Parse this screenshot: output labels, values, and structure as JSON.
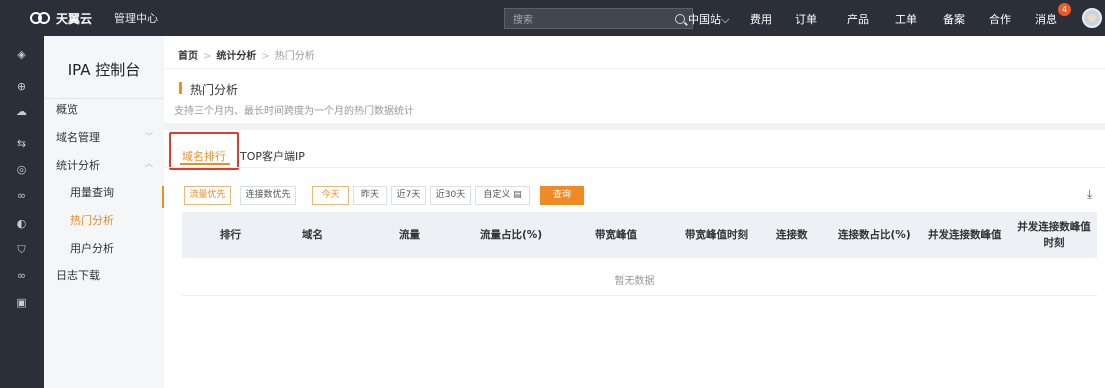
{
  "topbar": {
    "brand": "天翼云",
    "mgmt": "管理中心",
    "search_placeholder": "搜索",
    "nav": [
      "中国站⌵",
      "费用",
      "订单",
      "产品",
      "工单",
      "备案",
      "合作",
      "消息"
    ],
    "message_badge": "4"
  },
  "sidebar": {
    "title": "IPA 控制台",
    "items": {
      "overview": "概览",
      "domain_mgmt": "域名管理",
      "stats": "统计分析",
      "usage": "用量查询",
      "hot": "热门分析",
      "user": "用户分析",
      "logs": "日志下载"
    }
  },
  "breadcrumb": {
    "home": "首页",
    "section": "统计分析",
    "current": "热门分析",
    "sep": ">"
  },
  "page": {
    "title": "热门分析",
    "desc": "支持三个月内、最长时间跨度为一个月的热门数据统计"
  },
  "tabs": {
    "domain_rank": "域名排行",
    "top_ip": "TOP客户端IP"
  },
  "filters": {
    "mode": [
      "流量优先",
      "连接数优先"
    ],
    "range": [
      "今天",
      "昨天",
      "近7天",
      "近30天",
      "自定义 ▤"
    ],
    "query": "查询"
  },
  "table": {
    "headers": [
      "排行",
      "域名",
      "流量",
      "流量占比(%)",
      "带宽峰值",
      "带宽峰值时刻",
      "连接数",
      "连接数占比(%)",
      "并发连接数峰值"
    ],
    "last_header": "并发连接数峰值时刻",
    "empty": "暂无数据"
  },
  "colors": {
    "accent": "#f08a24",
    "topbar": "#2b2f3a",
    "highlight": "#e43a2d"
  }
}
